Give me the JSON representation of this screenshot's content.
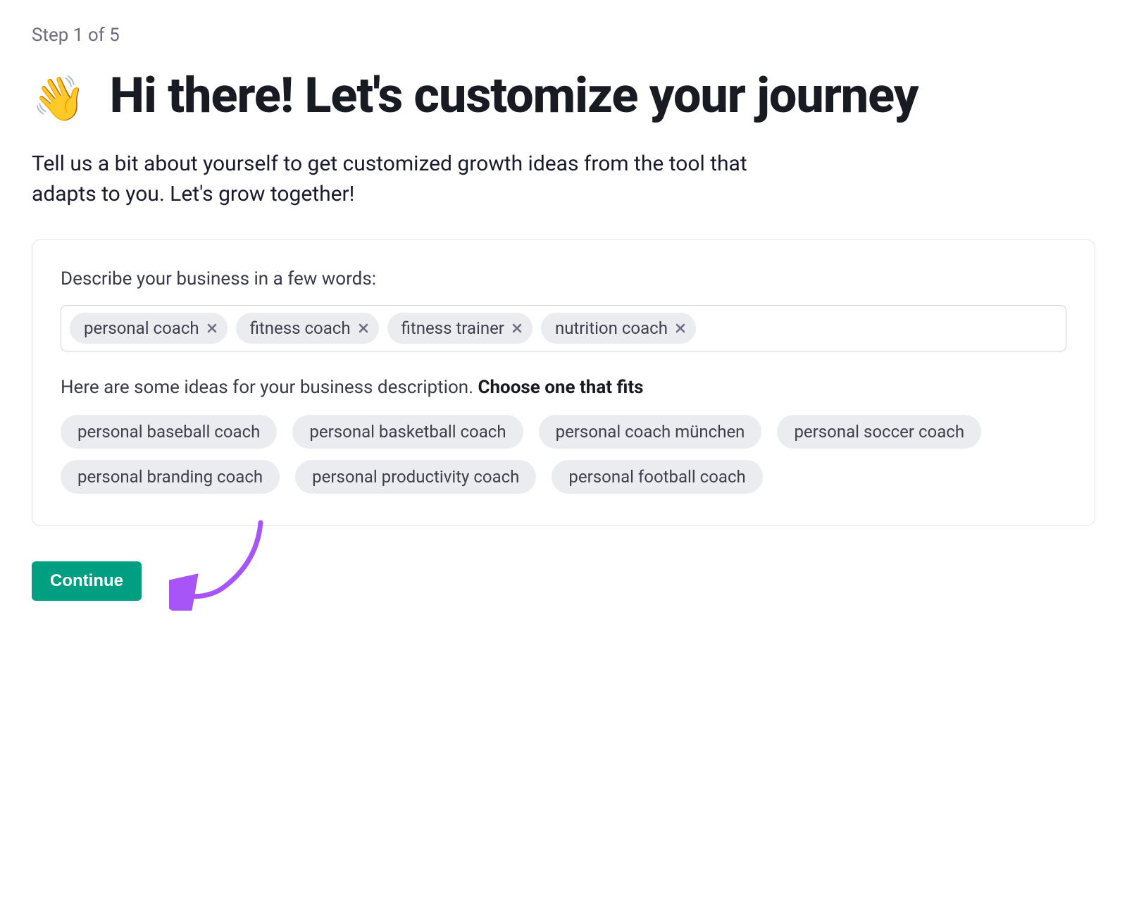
{
  "step": {
    "label": "Step 1 of 5"
  },
  "header": {
    "emoji": "👋",
    "title": " Hi there! Let's customize your journey",
    "subtitle": "Tell us a bit about yourself to get customized growth ideas from the tool that adapts to you. Let's grow together!"
  },
  "form": {
    "describe_label": "Describe your business in a few words:",
    "tags": [
      "personal coach",
      "fitness coach",
      "fitness trainer",
      "nutrition coach"
    ],
    "ideas_prefix": "Here are some ideas for your business description. ",
    "ideas_bold": "Choose one that fits",
    "suggestions": [
      "personal baseball coach",
      "personal basketball coach",
      "personal coach münchen",
      "personal soccer coach",
      "personal branding coach",
      "personal productivity coach",
      "personal football coach"
    ]
  },
  "actions": {
    "continue_label": "Continue"
  },
  "colors": {
    "primary_button": "#009f81",
    "tag_bg": "#ebecf0",
    "annotation_arrow": "#a855f7"
  }
}
